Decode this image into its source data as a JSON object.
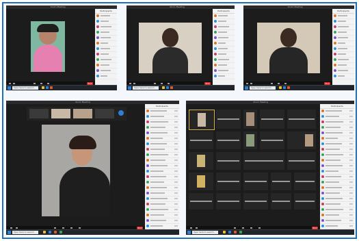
{
  "screens": [
    {
      "title": "Zoom Meeting",
      "search_placeholder": "Type here to search",
      "clock": "",
      "leave_label": "End",
      "participants_title": "Participants"
    },
    {
      "title": "Zoom Meeting",
      "search_placeholder": "Type here to search",
      "clock": "",
      "leave_label": "End",
      "participants_title": "Participants"
    },
    {
      "title": "Zoom Meeting",
      "search_placeholder": "Type here to search",
      "clock": "",
      "leave_label": "End",
      "participants_title": "Participants"
    },
    {
      "title": "Zoom Meeting",
      "search_placeholder": "Type here to search",
      "clock": "",
      "leave_label": "End",
      "participants_title": "Participants"
    },
    {
      "title": "Zoom Meeting",
      "search_placeholder": "Type here to search",
      "clock": "",
      "leave_label": "End",
      "participants_title": "Participants"
    }
  ],
  "colors": {
    "frame_border": "#1f6fb8",
    "leave_button": "#e02b2b",
    "start_button": "#2d7fd6",
    "app_bg": "#1a1a1a",
    "panel_bg": "#f3f3f3"
  },
  "icons": [
    "windows-start-icon",
    "search-icon",
    "microphone-icon",
    "video-camera-icon",
    "participants-icon",
    "chat-icon",
    "share-screen-icon",
    "record-icon"
  ]
}
